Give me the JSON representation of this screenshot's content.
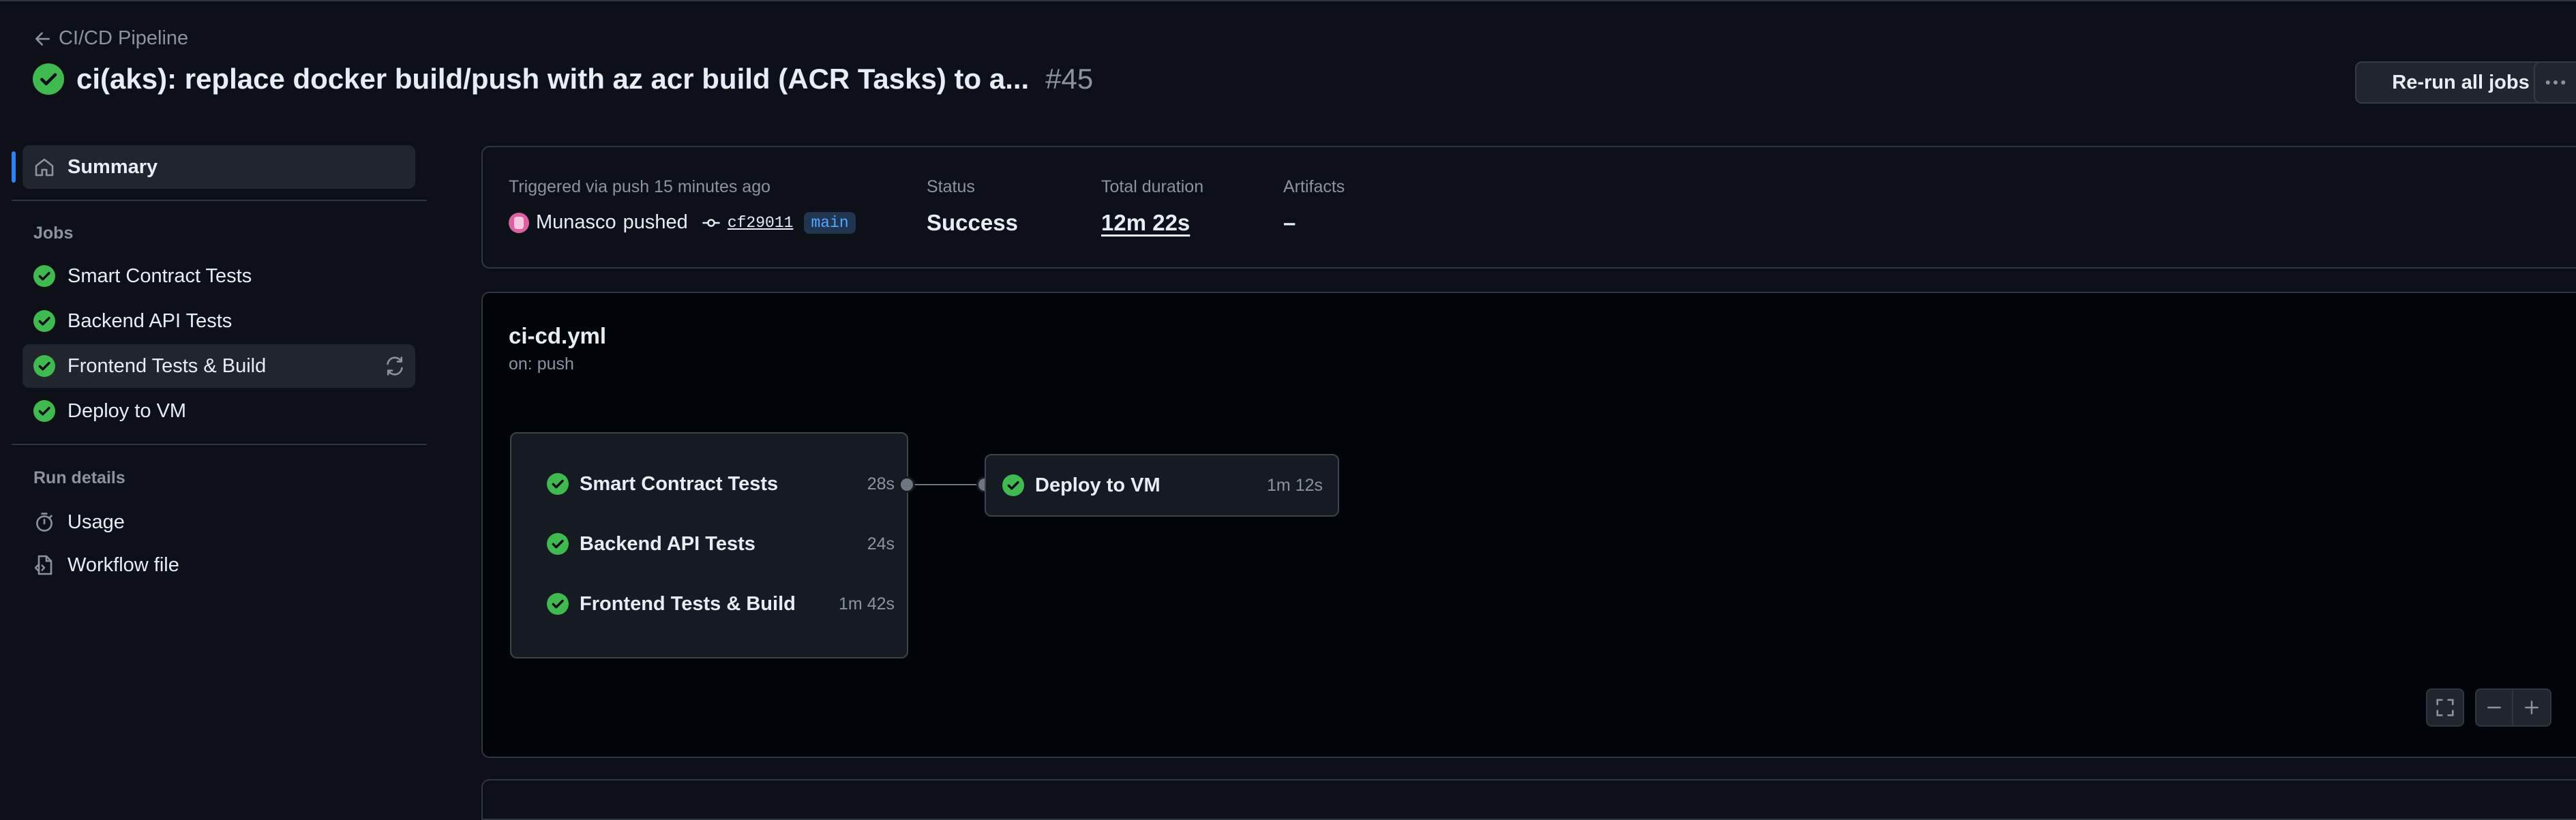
{
  "header": {
    "back_label": "CI/CD Pipeline",
    "title": "ci(aks): replace docker build/push with az acr build (ACR Tasks) to a...",
    "run_number": "#45",
    "rerun_label": "Re-run all jobs",
    "status": "success"
  },
  "sidebar": {
    "summary_label": "Summary",
    "jobs_heading": "Jobs",
    "jobs": [
      {
        "label": "Smart Contract Tests",
        "status": "success"
      },
      {
        "label": "Backend API Tests",
        "status": "success"
      },
      {
        "label": "Frontend Tests & Build",
        "status": "success"
      },
      {
        "label": "Deploy to VM",
        "status": "success"
      }
    ],
    "run_details_heading": "Run details",
    "usage_label": "Usage",
    "workflow_file_label": "Workflow file"
  },
  "summary": {
    "trigger_label": "Triggered via push 15 minutes ago",
    "actor": "Munasco",
    "action": "pushed",
    "commit_sha": "cf29011",
    "branch": "main",
    "status_label": "Status",
    "status_value": "Success",
    "duration_label": "Total duration",
    "duration_value": "12m 22s",
    "artifacts_label": "Artifacts",
    "artifacts_value": "–"
  },
  "graph": {
    "file": "ci-cd.yml",
    "on": "on: push",
    "group": [
      {
        "label": "Smart Contract Tests",
        "duration": "28s"
      },
      {
        "label": "Backend API Tests",
        "duration": "24s"
      },
      {
        "label": "Frontend Tests & Build",
        "duration": "1m 42s"
      }
    ],
    "deploy": {
      "label": "Deploy to VM",
      "duration": "1m 12s"
    }
  },
  "colors": {
    "background": "#0d1117",
    "success": "#3fb950",
    "accent": "#2f81f7",
    "branch_text": "#58a6ff"
  }
}
